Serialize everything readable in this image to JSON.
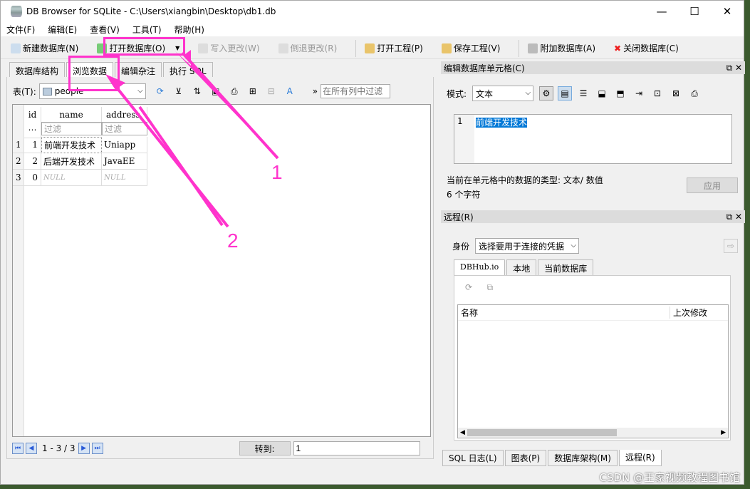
{
  "window": {
    "title": "DB Browser for SQLite - C:\\Users\\xiangbin\\Desktop\\db1.db",
    "minimize": "—",
    "maximize": "☐",
    "close": "✕"
  },
  "menu": [
    "文件(F)",
    "编辑(E)",
    "查看(V)",
    "工具(T)",
    "帮助(H)"
  ],
  "toolbar": {
    "new_db": "新建数据库(N)",
    "open_db": "打开数据库(O)",
    "write": "写入更改(W)",
    "revert": "倒退更改(R)",
    "open_project": "打开工程(P)",
    "save_project": "保存工程(V)",
    "attach": "附加数据库(A)",
    "close_db": "关闭数据库(C)"
  },
  "main_tabs": [
    "数据库结构",
    "浏览数据",
    "编辑杂注",
    "执行 SQL"
  ],
  "browse": {
    "table_label": "表(T):",
    "table_value": "people",
    "filter_placeholder": "在所有列中过滤",
    "columns": [
      "id",
      "name",
      "address"
    ],
    "filter_text": "过滤",
    "rows": [
      {
        "rownum": "1",
        "id": "1",
        "name": "前端开发技术",
        "address": "Uniapp"
      },
      {
        "rownum": "2",
        "id": "2",
        "name": "后端开发技术",
        "address": "JavaEE"
      },
      {
        "rownum": "3",
        "id": "0",
        "name": "NULL",
        "address": "NULL"
      }
    ],
    "pager": "1 - 3 / 3",
    "goto_label": "转到:",
    "goto_value": "1"
  },
  "edit_cell": {
    "title": "编辑数据库单元格(C)",
    "mode_label": "模式:",
    "mode_value": "文本",
    "line_no": "1",
    "content": "前端开发技术",
    "type_info": "当前在单元格中的数据的类型: 文本/ 数值",
    "char_count": "6 个字符",
    "apply": "应用"
  },
  "remote": {
    "title": "远程(R)",
    "identity_label": "身份",
    "identity_value": "选择要用于连接的凭据",
    "tabs": [
      "DBHub.io",
      "本地",
      "当前数据库"
    ],
    "col_name": "名称",
    "col_modified": "上次修改"
  },
  "bottom_tabs": [
    "SQL 日志(L)",
    "图表(P)",
    "数据库架构(M)",
    "远程(R)"
  ],
  "annotations": [
    "1",
    "2"
  ],
  "watermark": "CSDN @王家视频教程图书馆"
}
